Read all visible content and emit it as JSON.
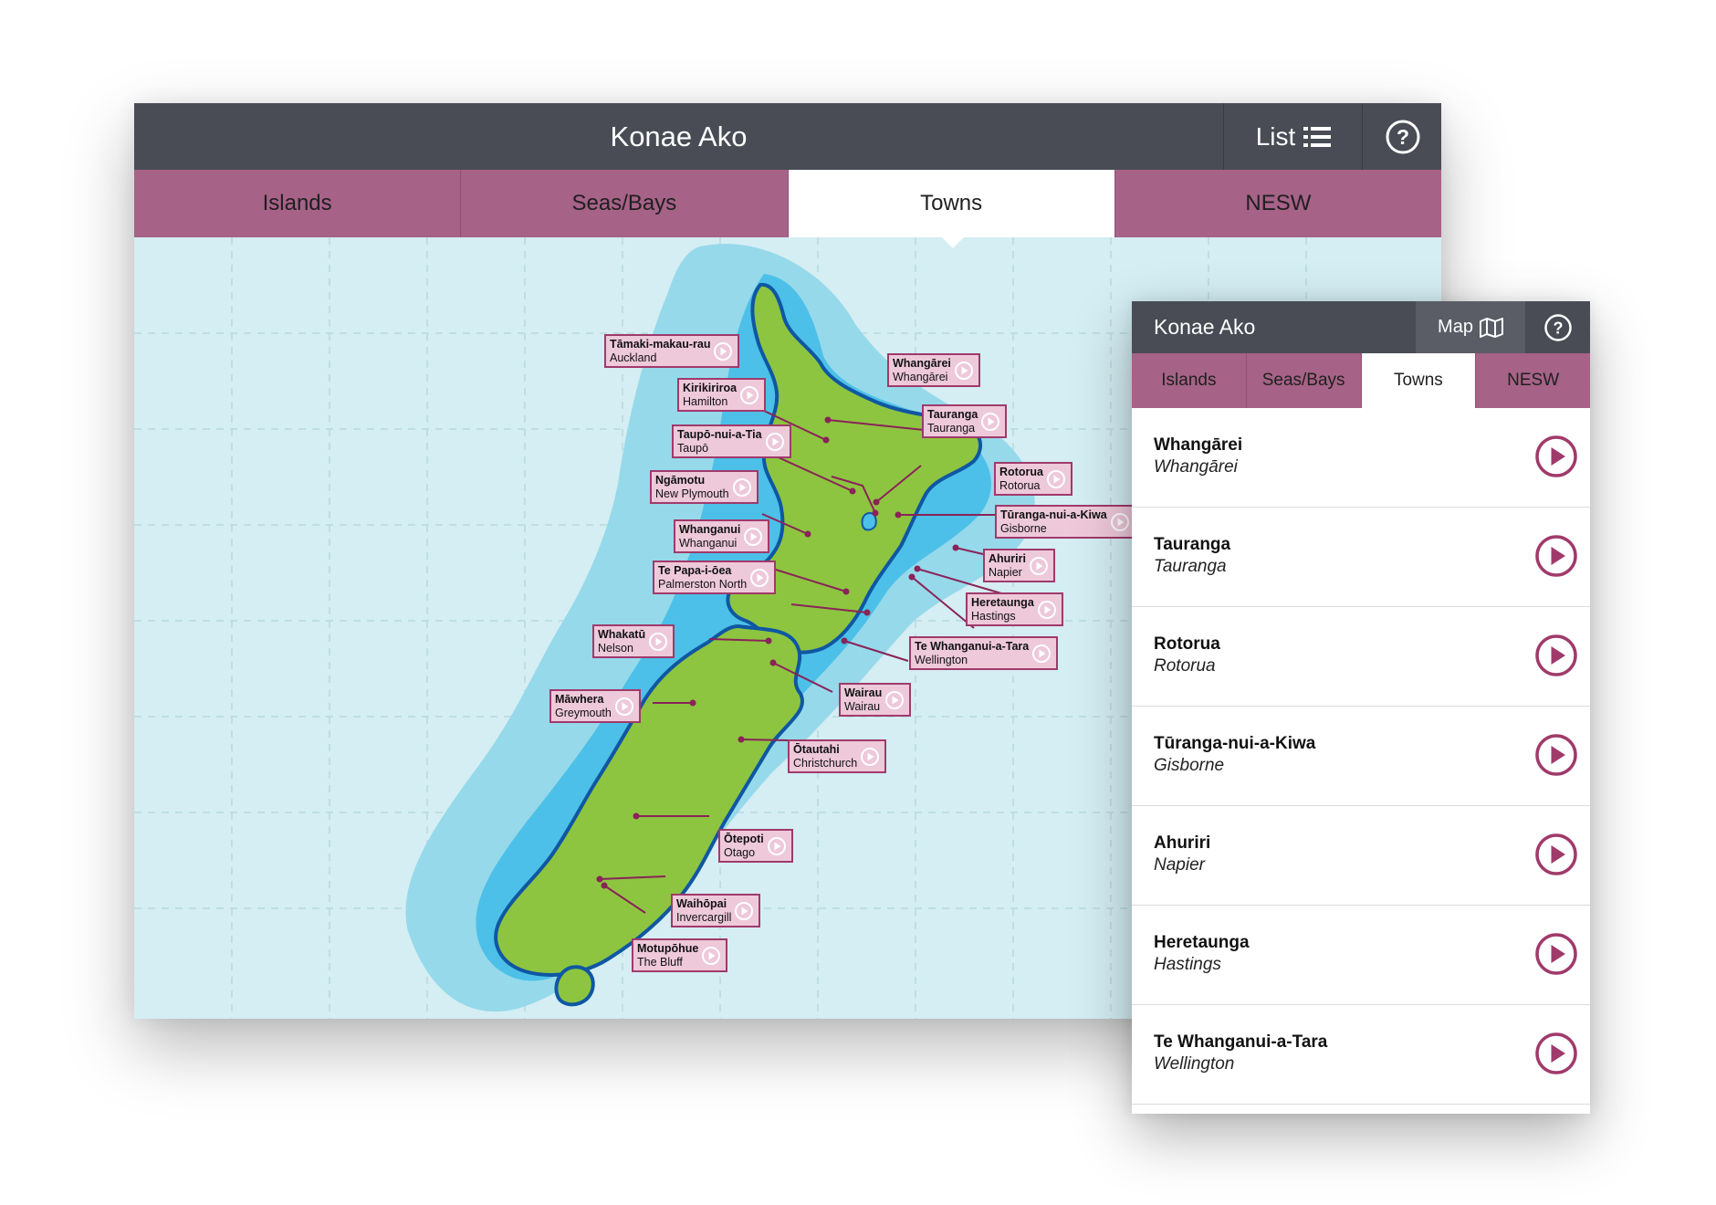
{
  "desktop": {
    "title": "Konae Ako",
    "list_label": "List",
    "tabs": [
      {
        "label": "Islands",
        "active": false
      },
      {
        "label": "Seas/Bays",
        "active": false
      },
      {
        "label": "Towns",
        "active": true
      },
      {
        "label": "NESW",
        "active": false
      }
    ],
    "towns": [
      {
        "name": "Tāmaki-makau-rau",
        "english": "Auckland"
      },
      {
        "name": "Kirikiriroa",
        "english": "Hamilton"
      },
      {
        "name": "Taupō-nui-a-Tia",
        "english": "Taupō"
      },
      {
        "name": "Ngāmotu",
        "english": "New Plymouth"
      },
      {
        "name": "Whanganui",
        "english": "Whanganui"
      },
      {
        "name": "Te Papa-i-ōea",
        "english": "Palmerston North"
      },
      {
        "name": "Whakatū",
        "english": "Nelson"
      },
      {
        "name": "Māwhera",
        "english": "Greymouth"
      },
      {
        "name": "Whangārei",
        "english": "Whangārei"
      },
      {
        "name": "Tauranga",
        "english": "Tauranga"
      },
      {
        "name": "Rotorua",
        "english": "Rotorua"
      },
      {
        "name": "Tūranga-nui-a-Kiwa",
        "english": "Gisborne"
      },
      {
        "name": "Ahuriri",
        "english": "Napier"
      },
      {
        "name": "Heretaunga",
        "english": "Hastings"
      },
      {
        "name": "Te Whanganui-a-Tara",
        "english": "Wellington"
      },
      {
        "name": "Wairau",
        "english": "Wairau"
      },
      {
        "name": "Ōtautahi",
        "english": "Christchurch"
      },
      {
        "name": "Ōtepoti",
        "english": "Otago"
      },
      {
        "name": "Waihōpai",
        "english": "Invercargill"
      },
      {
        "name": "Motupōhue",
        "english": "The Bluff"
      }
    ]
  },
  "mobile": {
    "title": "Konae Ako",
    "map_label": "Map",
    "tabs": [
      {
        "label": "Islands",
        "active": false
      },
      {
        "label": "Seas/Bays",
        "active": false
      },
      {
        "label": "Towns",
        "active": true
      },
      {
        "label": "NESW",
        "active": false
      }
    ],
    "list": [
      {
        "name": "Whangārei",
        "english": "Whangārei"
      },
      {
        "name": "Tauranga",
        "english": "Tauranga"
      },
      {
        "name": "Rotorua",
        "english": "Rotorua"
      },
      {
        "name": "Tūranga-nui-a-Kiwa",
        "english": "Gisborne"
      },
      {
        "name": "Ahuriri",
        "english": "Napier"
      },
      {
        "name": "Heretaunga",
        "english": "Hastings"
      },
      {
        "name": "Te Whanganui-a-Tara",
        "english": "Wellington"
      }
    ]
  },
  "colors": {
    "header": "#494c55",
    "tab": "#a66287",
    "sea": "#d4eef3",
    "land": "#8dc540",
    "accent": "#a03a6b"
  },
  "icons": [
    "list-icon",
    "help-icon",
    "map-icon",
    "play-icon"
  ]
}
